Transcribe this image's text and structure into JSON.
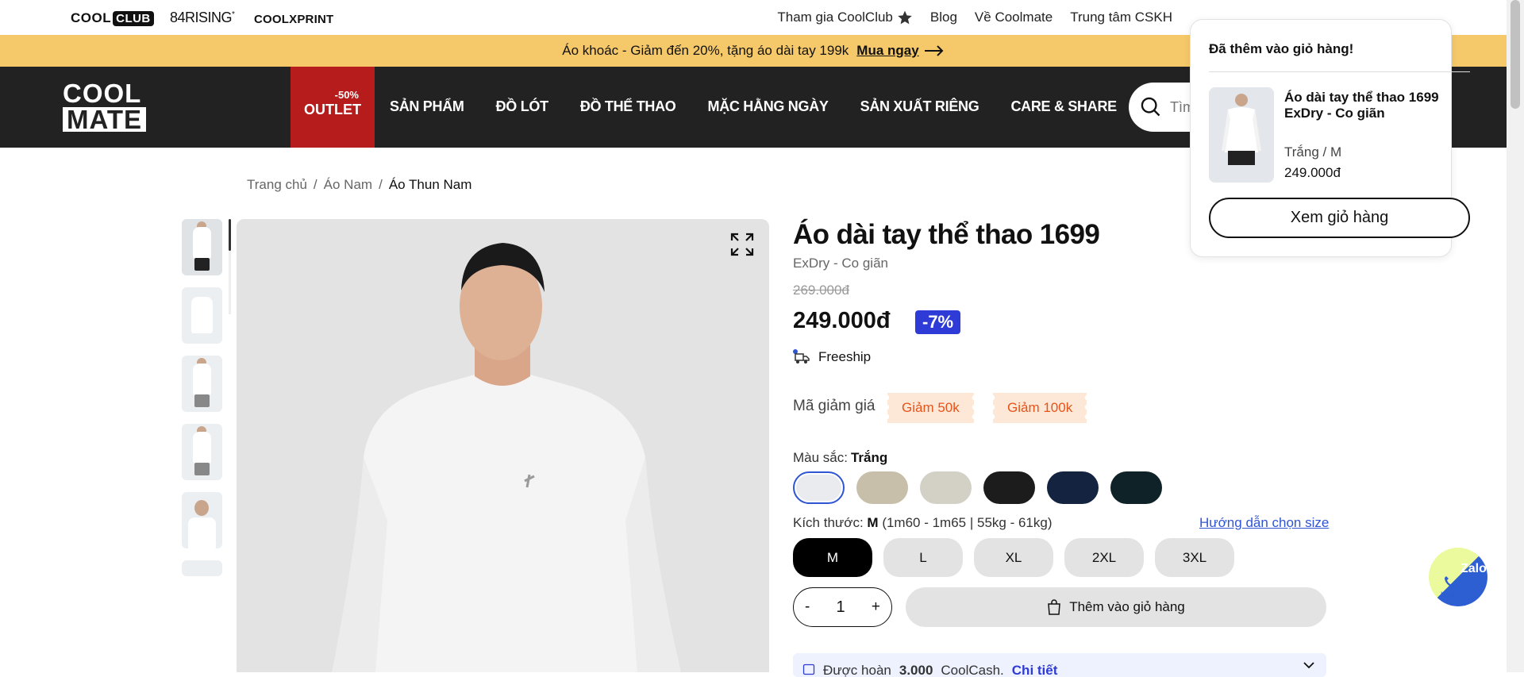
{
  "topbar": {
    "brand_club_a": "COOL",
    "brand_club_b": "CLUB",
    "brand_84": "84RISING",
    "brand_84_sup": "*",
    "brand_xprint": "COOLXPRINT",
    "links": [
      "Tham gia CoolClub",
      "Blog",
      "Về Coolmate",
      "Trung tâm CSKH"
    ]
  },
  "promo": {
    "text": "Áo khoác - Giảm đến 20%, tặng áo dài tay 199k",
    "cta": "Mua ngay"
  },
  "nav": {
    "logo_line1": "COOL",
    "logo_line2": "MATE",
    "outlet_pct": "-50%",
    "outlet_label": "OUTLET",
    "items": [
      "SẢN PHẨM",
      "ĐỒ LÓT",
      "ĐỒ THỂ THAO",
      "MẶC HẰNG NGÀY",
      "SẢN XUẤT RIÊNG",
      "CARE & SHARE"
    ],
    "search_placeholder": "Tìm kiếm"
  },
  "breadcrumb": {
    "items": [
      "Trang chủ",
      "Áo Nam",
      "Áo Thun Nam"
    ],
    "sep": "/"
  },
  "product": {
    "name": "Áo dài tay thể thao 1699",
    "subtitle": "ExDry - Co giãn",
    "old_price": "269.000đ",
    "price": "249.000đ",
    "discount": "-7%",
    "freeship": "Freeship",
    "voucher_label": "Mã giảm giá",
    "vouchers": [
      "Giảm 50k",
      "Giảm 100k"
    ],
    "color_label": "Màu sắc:",
    "color_selected": "Trắng",
    "colors": [
      "#e9ebee",
      "#c8bfaa",
      "#d3d0c6",
      "#1c1c1c",
      "#14233f",
      "#0f2228"
    ],
    "size_label": "Kích thước:",
    "size_selected": "M",
    "size_desc": "(1m60 - 1m65 | 55kg - 61kg)",
    "size_guide": "Hướng dẫn chọn size",
    "sizes": [
      "M",
      "L",
      "XL",
      "2XL",
      "3XL"
    ],
    "qty_minus": "-",
    "qty_value": "1",
    "qty_plus": "+",
    "add_to_cart": "Thêm vào giỏ hàng",
    "cashback_prefix": "Được hoàn",
    "cashback_amount": "3.000",
    "cashback_suffix": "CoolCash.",
    "cashback_link": "Chi tiết"
  },
  "popup": {
    "title": "Đã thêm vào giỏ hàng!",
    "item_name": "Áo dài tay thể thao 1699 ExDry - Co giãn",
    "variant": "Trắng / M",
    "price": "249.000đ",
    "view_cart": "Xem giỏ hàng"
  },
  "zalo": {
    "label": "Zalo",
    "hotline": "Hotline"
  }
}
